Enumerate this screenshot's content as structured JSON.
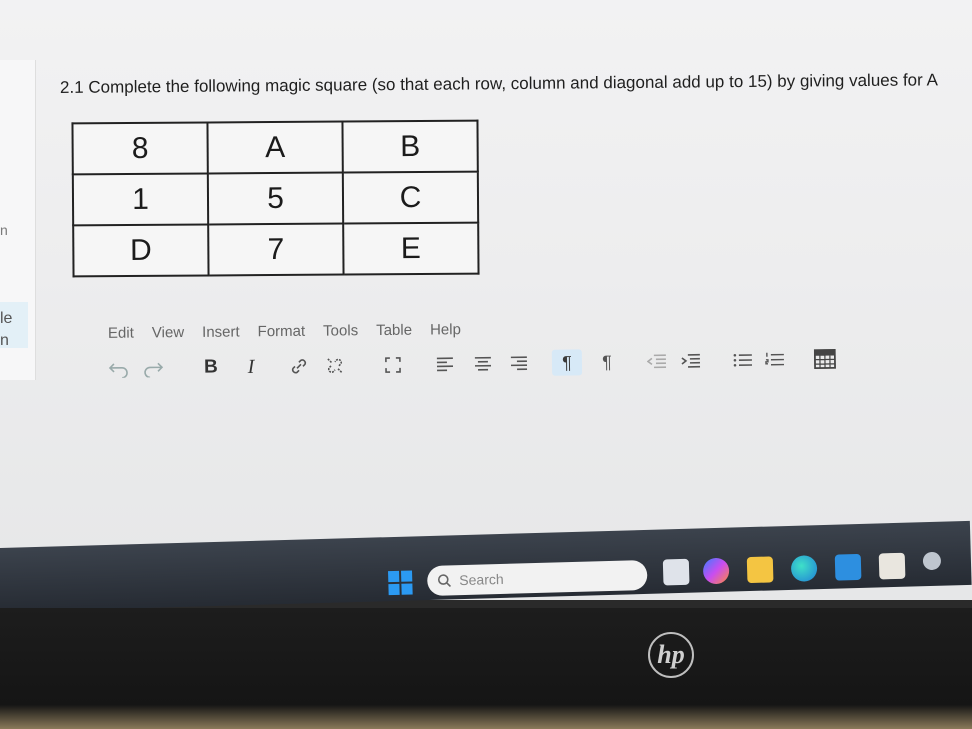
{
  "left_panel": {
    "frag1": "n",
    "frag2": "le",
    "frag3": "n"
  },
  "question": {
    "text": "2.1 Complete the following magic square (so that each row, column and diagonal add up to 15) by giving values for A"
  },
  "magic_square": {
    "rows": [
      [
        "8",
        "A",
        "B"
      ],
      [
        "1",
        "5",
        "C"
      ],
      [
        "D",
        "7",
        "E"
      ]
    ]
  },
  "menu": {
    "edit": "Edit",
    "view": "View",
    "insert": "Insert",
    "format": "Format",
    "tools": "Tools",
    "table": "Table",
    "help": "Help"
  },
  "toolbar": {
    "bold": "B",
    "italic": "I",
    "ltr": "¶",
    "rtl": "¶",
    "active": "ltr-button",
    "accent": "#d7e9f7"
  },
  "taskbar": {
    "search_placeholder": "Search",
    "accent": "#2b9af3"
  },
  "bezel": {
    "logo": "hp"
  }
}
